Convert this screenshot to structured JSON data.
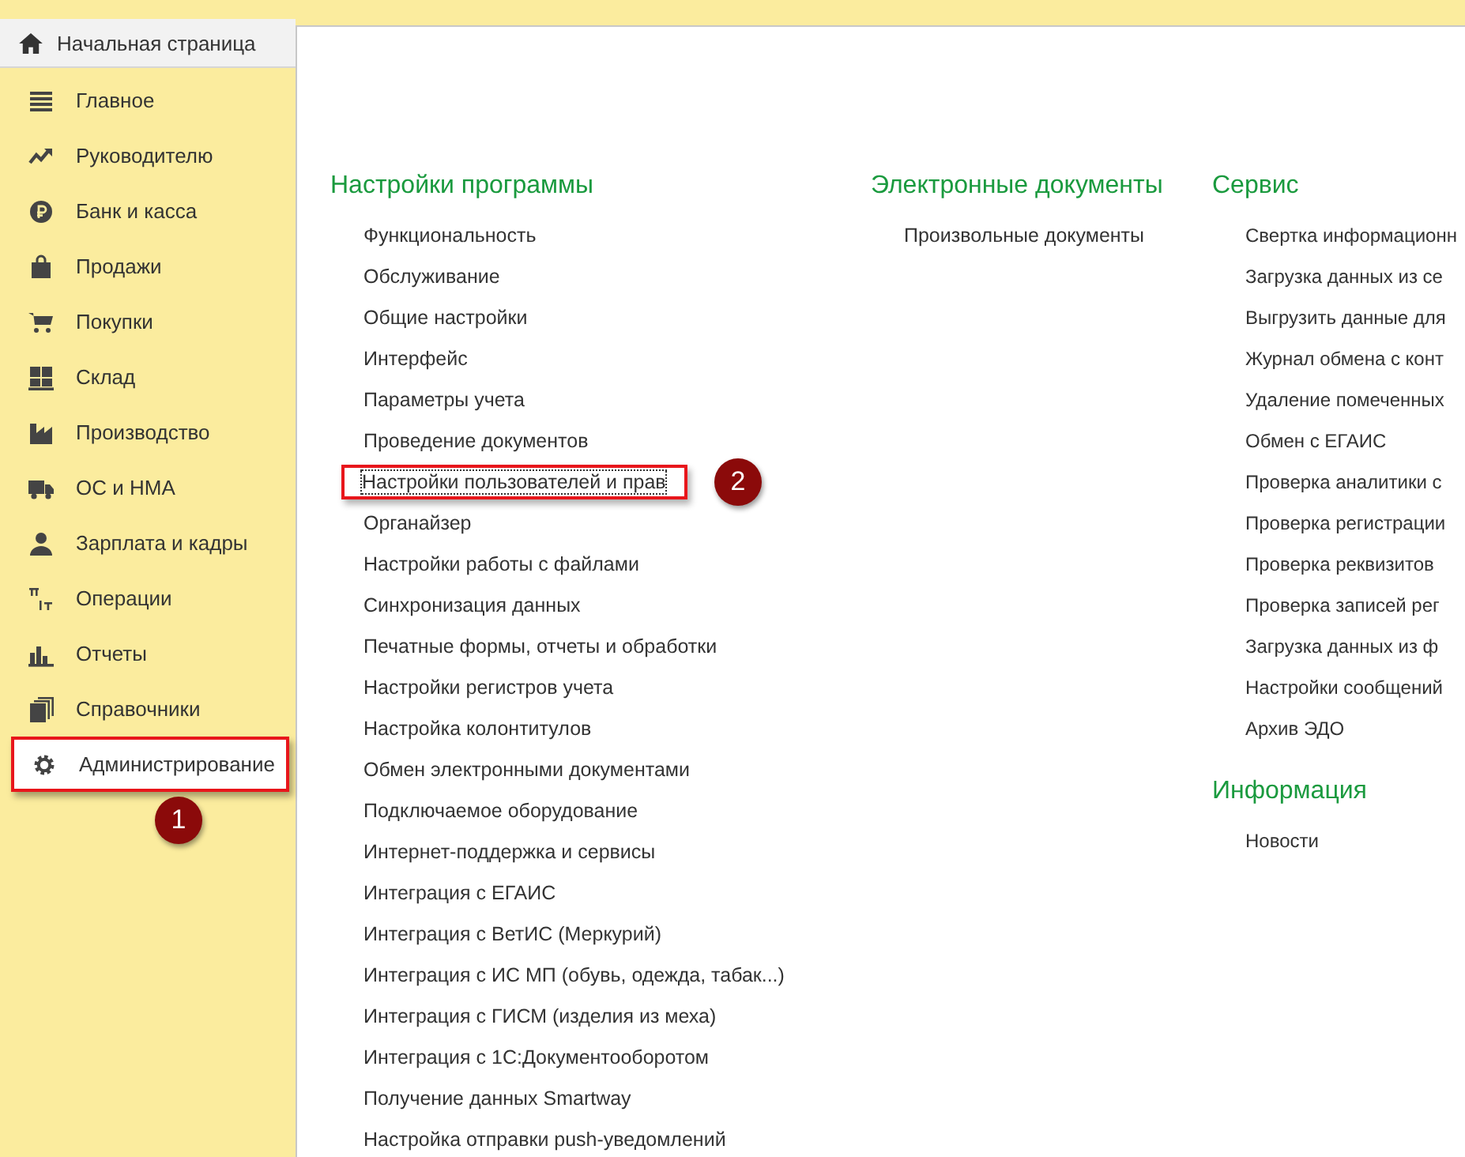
{
  "home_tab": {
    "label": "Начальная страница",
    "selected": true
  },
  "sidebar": {
    "items": [
      {
        "label": "Главное",
        "selected": false
      },
      {
        "label": "Руководителю",
        "selected": false
      },
      {
        "label": "Банк и касса",
        "selected": false
      },
      {
        "label": "Продажи",
        "selected": false
      },
      {
        "label": "Покупки",
        "selected": false
      },
      {
        "label": "Склад",
        "selected": false
      },
      {
        "label": "Производство",
        "selected": false
      },
      {
        "label": "ОС и НМА",
        "selected": false
      },
      {
        "label": "Зарплата и кадры",
        "selected": false
      },
      {
        "label": "Операции",
        "selected": false
      },
      {
        "label": "Отчеты",
        "selected": false
      },
      {
        "label": "Справочники",
        "selected": false
      },
      {
        "label": "Администрирование",
        "selected": true,
        "callout": "1"
      }
    ]
  },
  "sections": [
    {
      "title": "Настройки программы",
      "links": [
        {
          "label": "Функциональность"
        },
        {
          "label": "Обслуживание"
        },
        {
          "label": "Общие настройки"
        },
        {
          "label": "Интерфейс"
        },
        {
          "label": "Параметры учета"
        },
        {
          "label": "Проведение документов"
        },
        {
          "label": "Настройки пользователей и прав",
          "focused": true,
          "callout": "2"
        },
        {
          "label": "Органайзер"
        },
        {
          "label": "Настройки работы с файлами"
        },
        {
          "label": "Синхронизация данных"
        },
        {
          "label": "Печатные формы, отчеты и обработки"
        },
        {
          "label": "Настройки регистров учета"
        },
        {
          "label": "Настройка колонтитулов"
        },
        {
          "label": "Обмен электронными документами"
        },
        {
          "label": "Подключаемое оборудование"
        },
        {
          "label": "Интернет-поддержка и сервисы"
        },
        {
          "label": "Интеграция с ЕГАИС"
        },
        {
          "label": "Интеграция с ВетИС (Меркурий)"
        },
        {
          "label": "Интеграция с ИС МП (обувь, одежда, табак...)"
        },
        {
          "label": "Интеграция с ГИСМ (изделия из меха)"
        },
        {
          "label": "Интеграция с 1С:Документооборотом"
        },
        {
          "label": "Получение данных Smartway"
        },
        {
          "label": "Настройка отправки push-уведомлений"
        }
      ]
    },
    {
      "title": "Электронные документы",
      "links": [
        {
          "label": "Произвольные документы"
        }
      ]
    },
    {
      "title": "Сервис",
      "links": [
        {
          "label": "Свертка информационн"
        },
        {
          "label": "Загрузка данных из се"
        },
        {
          "label": "Выгрузить данные для"
        },
        {
          "label": "Журнал обмена с конт"
        },
        {
          "label": "Удаление помеченных"
        },
        {
          "label": "Обмен с ЕГАИС"
        },
        {
          "label": "Проверка аналитики с"
        },
        {
          "label": "Проверка регистрации"
        },
        {
          "label": "Проверка реквизитов"
        },
        {
          "label": "Проверка записей рег"
        },
        {
          "label": "Загрузка данных из ф"
        },
        {
          "label": "Настройки сообщений"
        },
        {
          "label": "Архив ЭДО"
        }
      ]
    },
    {
      "title": "Информация",
      "links": [
        {
          "label": "Новости"
        }
      ]
    }
  ]
}
